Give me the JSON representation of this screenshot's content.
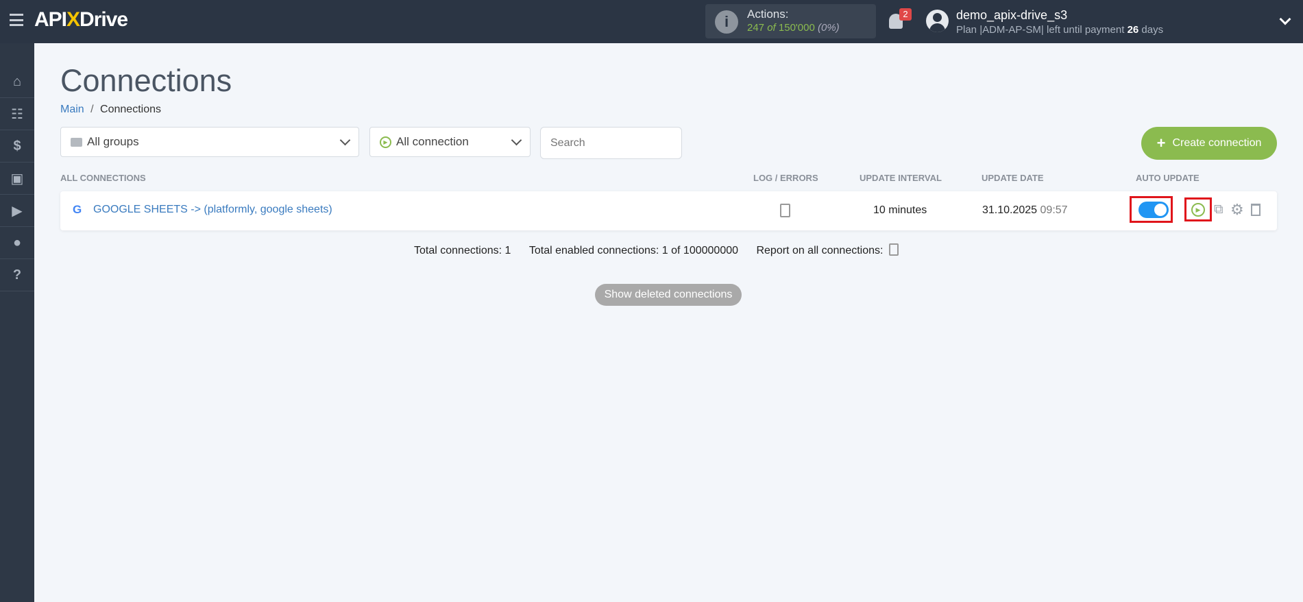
{
  "header": {
    "logo": "APIXDrive",
    "actions_label": "Actions:",
    "actions_used": "247",
    "actions_of": "of",
    "actions_total": "150'000",
    "actions_pct": "(0%)",
    "notifications": "2",
    "username": "demo_apix-drive_s3",
    "plan_prefix": "Plan |ADM-AP-SM| left until payment",
    "plan_days": "26",
    "plan_suffix": "days"
  },
  "sidebar": {
    "items": [
      {
        "icon": "home-icon"
      },
      {
        "icon": "sitemap-icon"
      },
      {
        "icon": "dollar-icon"
      },
      {
        "icon": "briefcase-icon"
      },
      {
        "icon": "youtube-icon"
      },
      {
        "icon": "user-icon"
      },
      {
        "icon": "help-icon"
      }
    ]
  },
  "page": {
    "title": "Connections",
    "breadcrumb": {
      "main": "Main",
      "sep": "/",
      "current": "Connections"
    }
  },
  "filters": {
    "groups": "All groups",
    "connection": "All connection",
    "search_placeholder": "Search",
    "create": "Create connection"
  },
  "table": {
    "headers": {
      "all": "ALL CONNECTIONS",
      "log": "LOG / ERRORS",
      "interval": "UPDATE INTERVAL",
      "date": "UPDATE DATE",
      "auto": "AUTO UPDATE"
    },
    "rows": [
      {
        "name": "GOOGLE SHEETS -> (platformly, google sheets)",
        "interval": "10 minutes",
        "date": "31.10.2025",
        "time": "09:57",
        "auto_update": true
      }
    ]
  },
  "footer": {
    "total": "Total connections: 1",
    "enabled": "Total enabled connections: 1 of 100000000",
    "report": "Report on all connections:",
    "show_deleted": "Show deleted connections"
  },
  "colors": {
    "accent": "#8bbb4f",
    "link": "#3a7bbf",
    "toggle": "#2196f3",
    "highlight": "#e0151b"
  }
}
